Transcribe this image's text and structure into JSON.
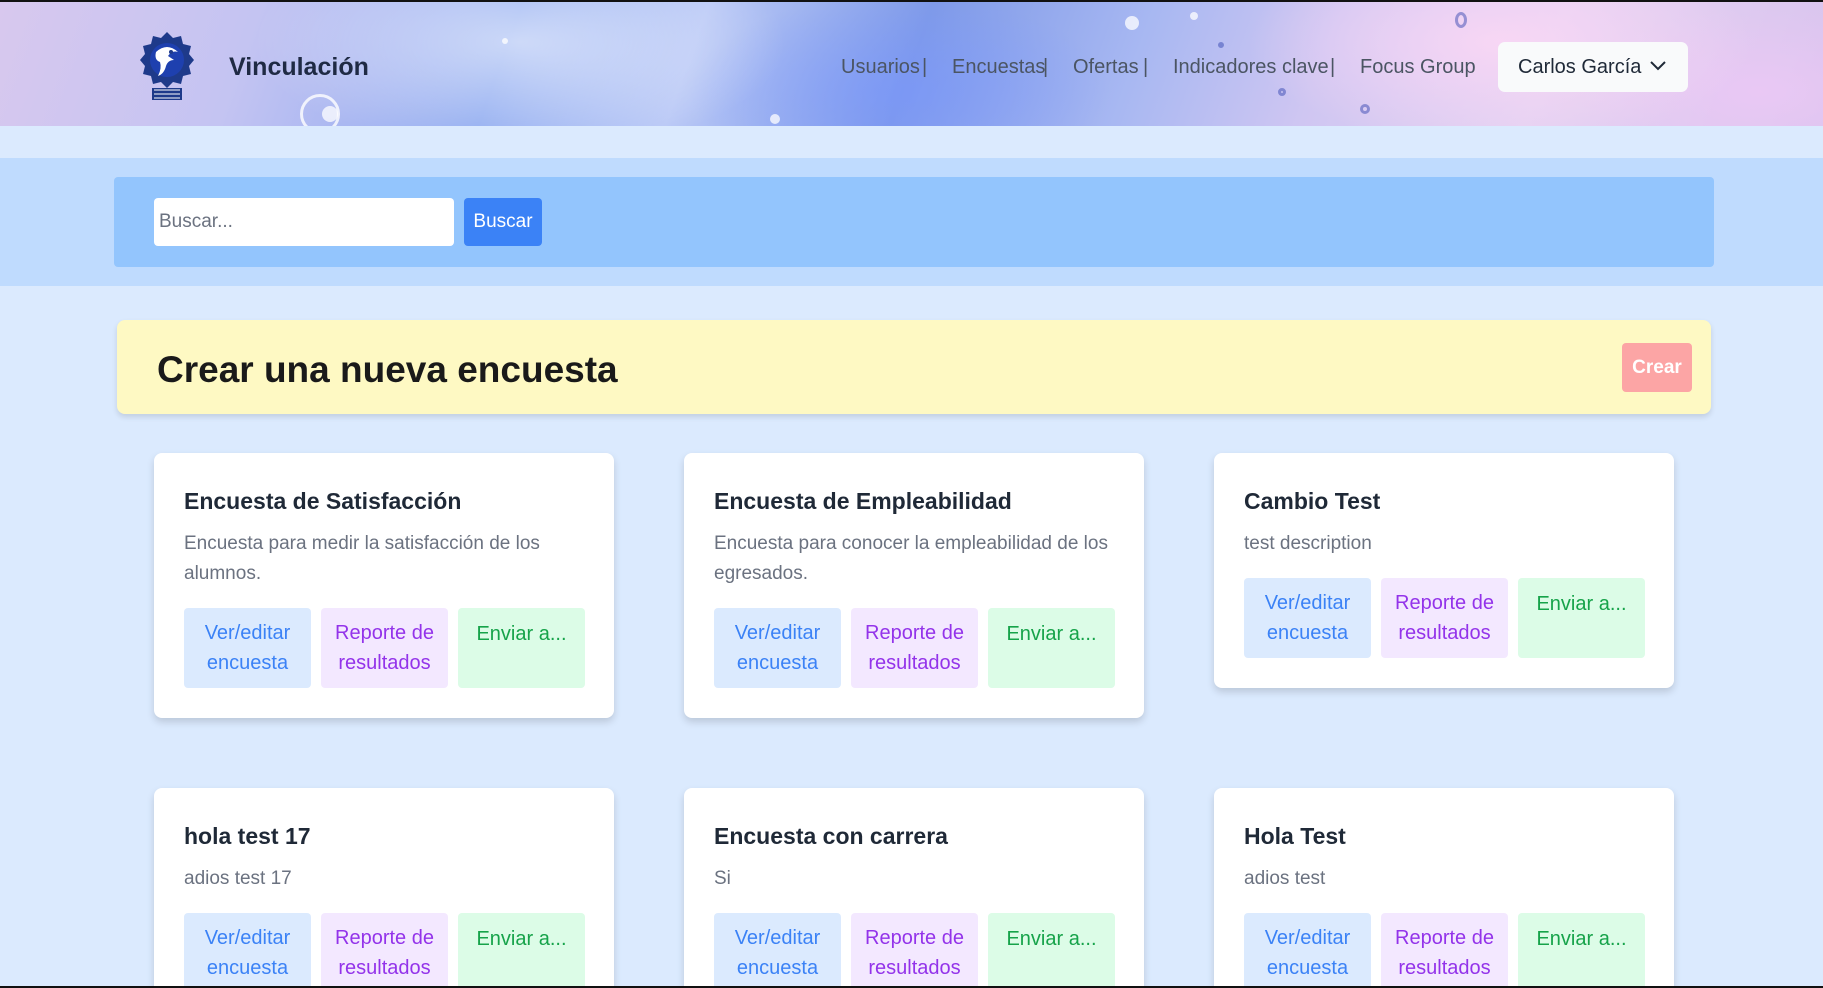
{
  "brand": {
    "name": "Vinculación",
    "logo_icon": "institute-eagle-logo-icon"
  },
  "nav": {
    "links": [
      {
        "label": "Usuarios",
        "sep": "|"
      },
      {
        "label": "Encuestas",
        "sep": "|"
      },
      {
        "label": "Ofertas",
        "sep": "|"
      },
      {
        "label": "Indicadores clave",
        "sep": "|"
      },
      {
        "label": "Focus Group",
        "sep": ""
      }
    ],
    "user": {
      "name": "Carlos García",
      "icon": "chevron-down-icon"
    }
  },
  "search": {
    "placeholder": "Buscar...",
    "value": "",
    "button_label": "Buscar"
  },
  "create": {
    "title": "Crear una nueva encuesta",
    "button_label": "Crear"
  },
  "cards": [
    {
      "title": "Encuesta de Satisfacción",
      "description": "Encuesta para medir la satisfacción de los alumnos.",
      "view_label": "Ver/editar encuesta",
      "report_label": "Reporte de resultados",
      "send_label": "Enviar a..."
    },
    {
      "title": "Encuesta de Empleabilidad",
      "description": "Encuesta para conocer la empleabilidad de los egresados.",
      "view_label": "Ver/editar encuesta",
      "report_label": "Reporte de resultados",
      "send_label": "Enviar a..."
    },
    {
      "title": "Cambio Test",
      "description": "test description",
      "view_label": "Ver/editar encuesta",
      "report_label": "Reporte de resultados",
      "send_label": "Enviar a..."
    },
    {
      "title": "hola test 17",
      "description": "adios test 17",
      "view_label": "Ver/editar encuesta",
      "report_label": "Reporte de resultados",
      "send_label": "Enviar a..."
    },
    {
      "title": "Encuesta con carrera",
      "description": "Si",
      "view_label": "Ver/editar encuesta",
      "report_label": "Reporte de resultados",
      "send_label": "Enviar a..."
    },
    {
      "title": "Hola Test",
      "description": "adios test",
      "view_label": "Ver/editar encuesta",
      "report_label": "Reporte de resultados",
      "send_label": "Enviar a..."
    }
  ],
  "colors": {
    "page_bg": "#dbeafe",
    "search_band": "#bfdbfe",
    "search_box": "#93c5fd",
    "primary": "#3b82f6",
    "create_banner": "#fef9c3",
    "create_button": "#fca5a5",
    "view_bg": "#dbeafe",
    "report_bg": "#f3e8ff",
    "send_bg": "#dcfce7"
  }
}
